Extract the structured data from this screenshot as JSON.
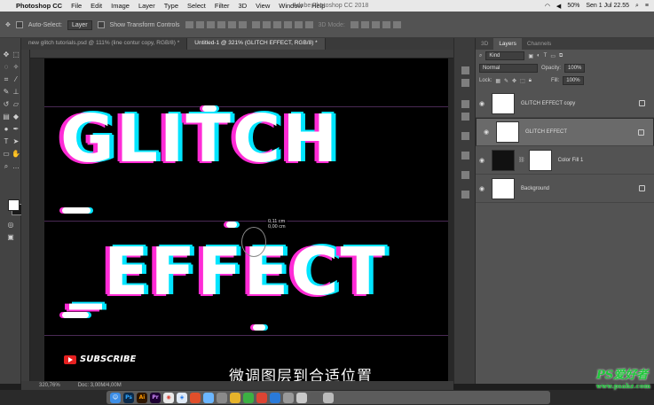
{
  "menubar": {
    "apple": "",
    "app": "Photoshop CC",
    "items": [
      "File",
      "Edit",
      "Image",
      "Layer",
      "Type",
      "Select",
      "Filter",
      "3D",
      "View",
      "Window",
      "Help"
    ],
    "window_title": "Adobe Photoshop CC 2018",
    "battery": "50%",
    "clock": "Sen 1 Jul  22.55"
  },
  "options": {
    "auto_select_label": "Auto-Select:",
    "auto_select_value": "Layer",
    "show_transform_label": "Show Transform Controls",
    "mode_3d_label": "3D Mode:"
  },
  "tabs": [
    {
      "label": "new glitch tutorials.psd @ 111% (line contur copy, RGB/8) *"
    },
    {
      "label": "Untitled-1 @ 321% (GLITCH EFFECT, RGB/8) *"
    }
  ],
  "canvas": {
    "line1": "GLITCH",
    "line2": "_EFFECT",
    "measure_dx": "0,11 cm",
    "measure_dy": "0,00 cm",
    "subscribe": "SUBSCRIBE",
    "subtitle": "微调图层到合适位置"
  },
  "status": {
    "zoom": "320,76%",
    "doc": "Doc: 3,00M/4,00M"
  },
  "panel": {
    "tabs": [
      "3D",
      "Layers",
      "Channels"
    ],
    "active_tab": "Layers",
    "kind": "Kind",
    "blend_mode": "Normal",
    "opacity_label": "Opacity:",
    "opacity": "100%",
    "lock_label": "Lock:",
    "fill_label": "Fill:",
    "fill": "100%"
  },
  "layers": [
    {
      "name": "GLITCH EFFECT copy",
      "selected": false
    },
    {
      "name": "GLITCH EFFECT",
      "selected": true
    },
    {
      "name": "Color Fill 1",
      "selected": false
    },
    {
      "name": "Background",
      "selected": false
    }
  ],
  "dock": {
    "icons": [
      "Finder",
      "Ps",
      "Ai",
      "Pr",
      "Chrome",
      "Safari",
      "Files",
      "App",
      "App",
      "App",
      "App",
      "App",
      "App",
      "App",
      "App",
      "App",
      "Trash"
    ]
  },
  "watermark": {
    "text": "PS爱好者",
    "url": "www.psahz.com"
  },
  "colors": {
    "magenta": "#ff2bd6",
    "cyan": "#00e5ff",
    "panel": "#535353"
  }
}
